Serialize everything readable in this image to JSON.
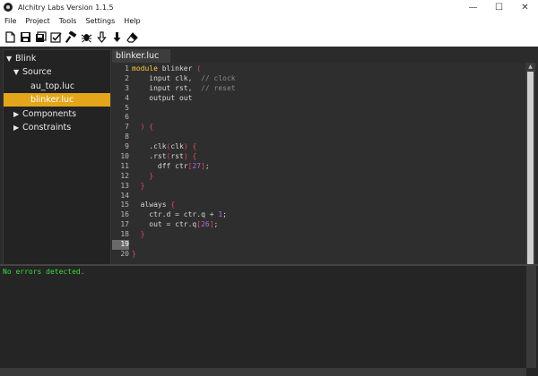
{
  "window": {
    "title": "Alchitry Labs Version 1.1.5"
  },
  "menu": [
    "File",
    "Project",
    "Tools",
    "Settings",
    "Help"
  ],
  "toolbar_icons": [
    "new-file-icon",
    "save-icon",
    "save-all-icon",
    "check-icon",
    "build-hammer-icon",
    "debug-bug-icon",
    "load-flash-icon",
    "load-ram-icon",
    "erase-icon"
  ],
  "project_tree": {
    "project_name": "Blink",
    "source_label": "Source",
    "files": [
      "au_top.luc",
      "blinker.luc"
    ],
    "selected_file": "blinker.luc",
    "components_label": "Components",
    "constraints_label": "Constraints"
  },
  "editor": {
    "tab_label": "blinker.luc",
    "current_line": 19,
    "line_numbers": [
      "1",
      "2",
      "3",
      "4",
      "5",
      "6",
      "7",
      "8",
      "9",
      "10",
      "11",
      "12",
      "13",
      "14",
      "15",
      "16",
      "17",
      "18",
      "19",
      "20"
    ],
    "code_lines": [
      "module blinker (",
      "    input clk,  // clock",
      "    input rst,  // reset",
      "    output out",
      "",
      "",
      "  ) {",
      "",
      "    .clk(clk) {",
      "    .rst(rst) {",
      "      dff ctr[27];",
      "    }",
      "  }",
      "",
      "  always {",
      "    ctr.d = ctr.q + 1;",
      "    out = ctr.q[26];",
      "  }",
      "",
      "}"
    ]
  },
  "console": {
    "message": "No errors detected."
  },
  "colors": {
    "selection": "#e3a61b",
    "keyword": "#ffc83d",
    "io_keyword": "#3fc4e0",
    "comment": "#8a8a8a",
    "console_text": "#3ddc3d"
  }
}
